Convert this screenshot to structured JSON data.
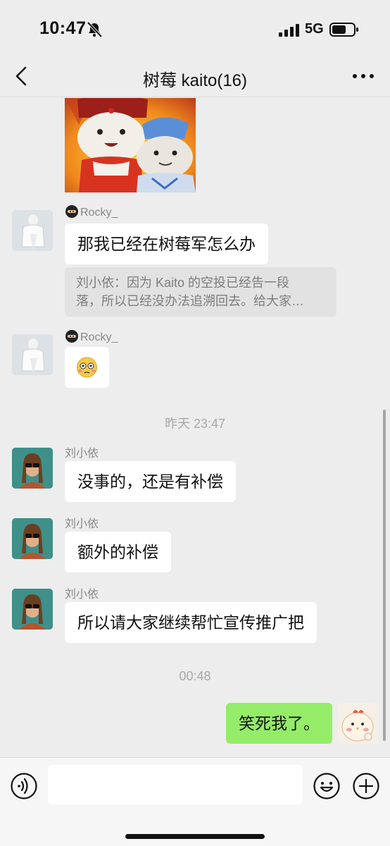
{
  "status_bar": {
    "time": "10:47",
    "network": "5G"
  },
  "nav": {
    "title": "树莓 kaito(16)"
  },
  "messages": [
    {
      "sender": "Rocky_",
      "text": "那我已经在树莓军怎么办"
    },
    {
      "quote_line1": "刘小依：因为 Kaito 的空投已经告一段",
      "quote_line2": "落，所以已经没办法追溯回去。给大家…"
    },
    {
      "sender": "Rocky_",
      "emoji": "flushed-face"
    },
    {
      "timestamp": "昨天 23:47"
    },
    {
      "sender": "刘小依",
      "text": "没事的，还是有补偿"
    },
    {
      "sender": "刘小依",
      "text": "额外的补偿"
    },
    {
      "sender": "刘小依",
      "text": "所以请大家继续帮忙宣传推广把"
    },
    {
      "timestamp": "00:48"
    },
    {
      "text": "笑死我了。"
    }
  ],
  "input": {
    "placeholder": ""
  },
  "colors": {
    "background": "#ededed",
    "bubble_in": "#ffffff",
    "bubble_out": "#95ec69",
    "quote_bg": "#e2e2e2"
  }
}
